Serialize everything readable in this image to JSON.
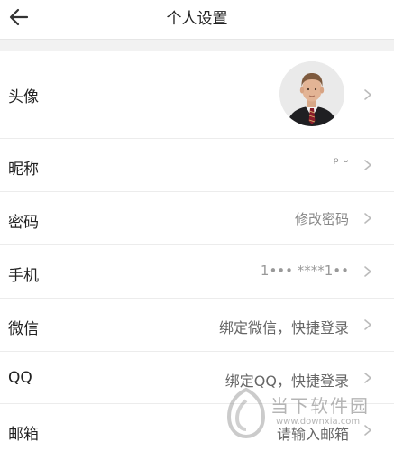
{
  "header": {
    "title": "个人设置"
  },
  "rows": [
    {
      "label": "头像",
      "value": ""
    },
    {
      "label": "昵称",
      "value": "ᵖ ᵕ"
    },
    {
      "label": "密码",
      "value": "修改密码"
    },
    {
      "label": "手机",
      "value": "1••• ****1••"
    },
    {
      "label": "微信",
      "value": "绑定微信，快捷登录"
    },
    {
      "label": "QQ",
      "value": "绑定QQ，快捷登录"
    },
    {
      "label": "邮箱",
      "value": "请输入邮箱"
    }
  ],
  "watermark": {
    "name": "当下软件园",
    "url": "www.downxia.com"
  },
  "icons": {
    "back": "arrow-left-icon",
    "chevron": "chevron-right-icon",
    "avatar": "user-avatar"
  }
}
